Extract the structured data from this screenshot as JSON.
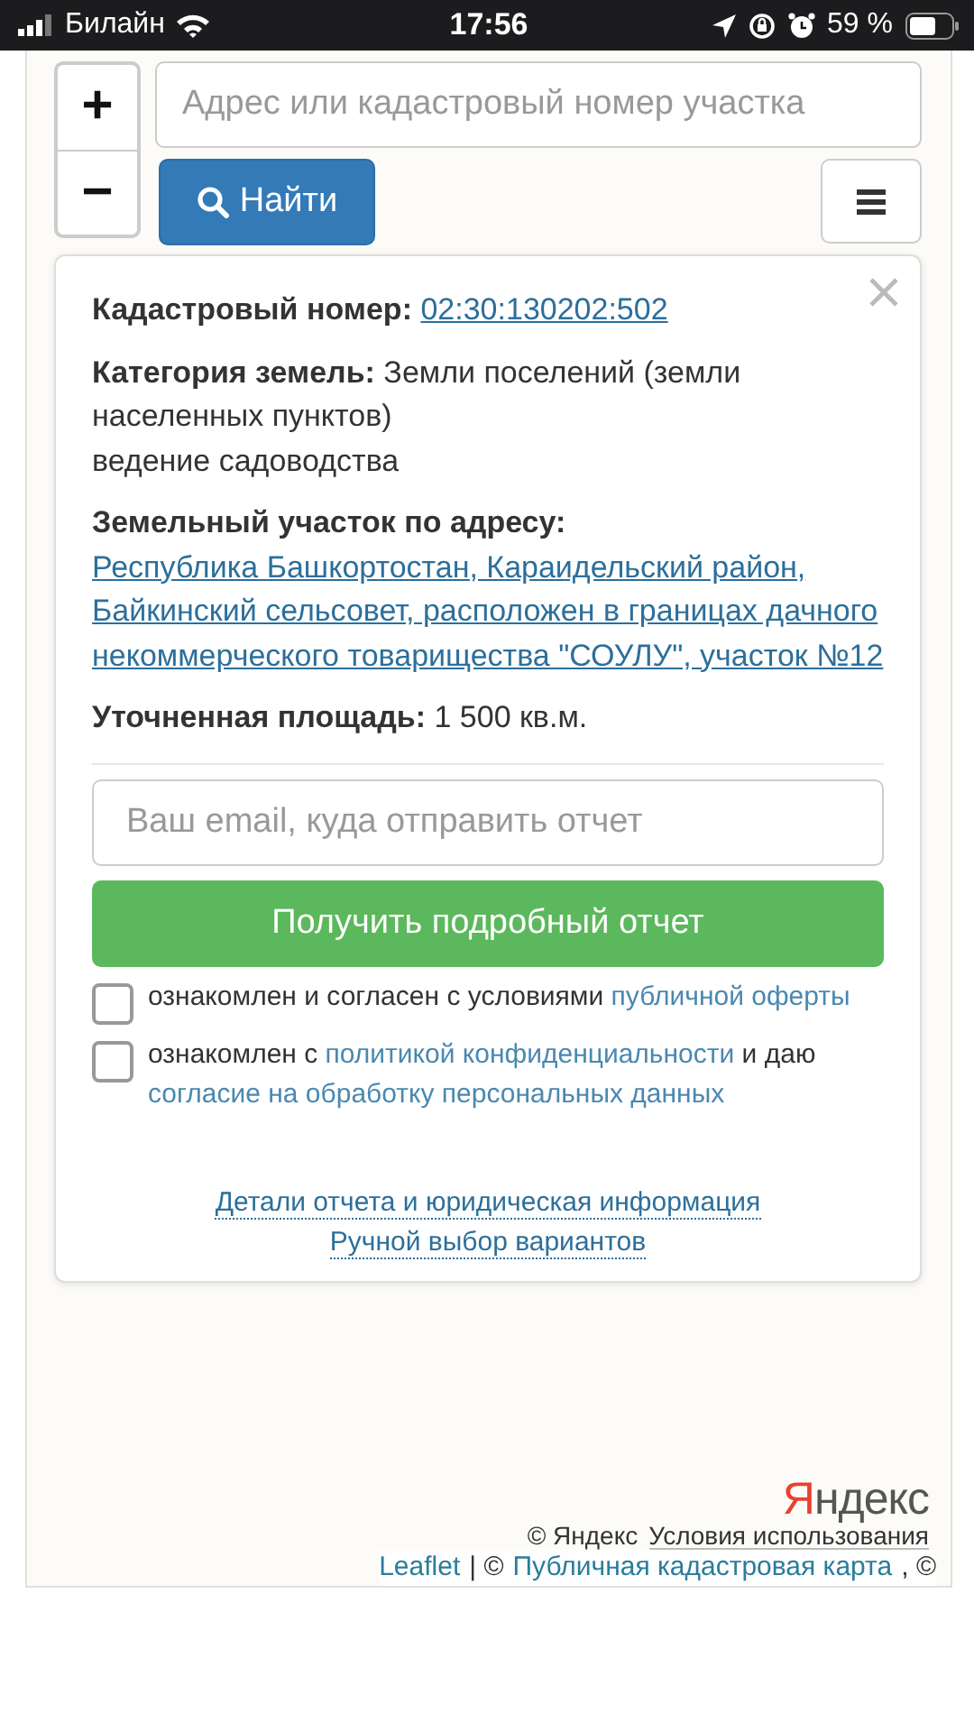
{
  "status_bar": {
    "carrier": "Билайн",
    "time": "17:56",
    "battery": "59 %"
  },
  "zoom": {
    "in": "+",
    "out": "−"
  },
  "search": {
    "placeholder": "Адрес или кадастровый номер участка",
    "button": "Найти"
  },
  "popup": {
    "fields": [
      {
        "kind": "link",
        "label": "Кадастровый номер:",
        "value": "02:30:130202:502"
      },
      {
        "kind": "text",
        "label": "Категория земель:",
        "value": "Земли поселений (земли населенных пунктов)",
        "note": "ведение садоводства"
      },
      {
        "kind": "link",
        "label": "Земельный участок по адресу:",
        "value": "Республика Башкортостан, Караидельский район, Байкинский сельсовет, расположен в границах дачного некоммерческого товарищества \"СОУЛУ\", участок №12"
      },
      {
        "kind": "text",
        "label": "Уточненная площадь:",
        "value": "1 500 кв.м."
      }
    ],
    "email_placeholder": "Ваш email, куда отправить отчет",
    "report_button": "Получить подробный отчет",
    "consents": [
      {
        "checked": false,
        "parts": [
          {
            "kind": "text",
            "text": "ознакомлен и согласен с условиями "
          },
          {
            "kind": "link",
            "text": "публичной оферты"
          }
        ]
      },
      {
        "checked": false,
        "parts": [
          {
            "kind": "text",
            "text": "ознакомлен с "
          },
          {
            "kind": "link",
            "text": "политикой конфиденциальности"
          },
          {
            "kind": "text",
            "text": " и даю "
          },
          {
            "kind": "link",
            "text": "согласие на обработку персональных данных"
          }
        ]
      }
    ],
    "links": [
      "Детали отчета и юридическая информация",
      "Ручной выбор вариантов"
    ]
  },
  "attribution": {
    "logo_first": "Я",
    "logo_rest": "ндекс",
    "copyright": "© Яндекс",
    "terms": "Условия использования",
    "line2": [
      {
        "kind": "link",
        "text": "Leaflet"
      },
      {
        "kind": "text",
        "text": "| ©"
      },
      {
        "kind": "link",
        "text": "Публичная кадастровая карта"
      },
      {
        "kind": "text",
        "text": ", ©"
      }
    ]
  }
}
